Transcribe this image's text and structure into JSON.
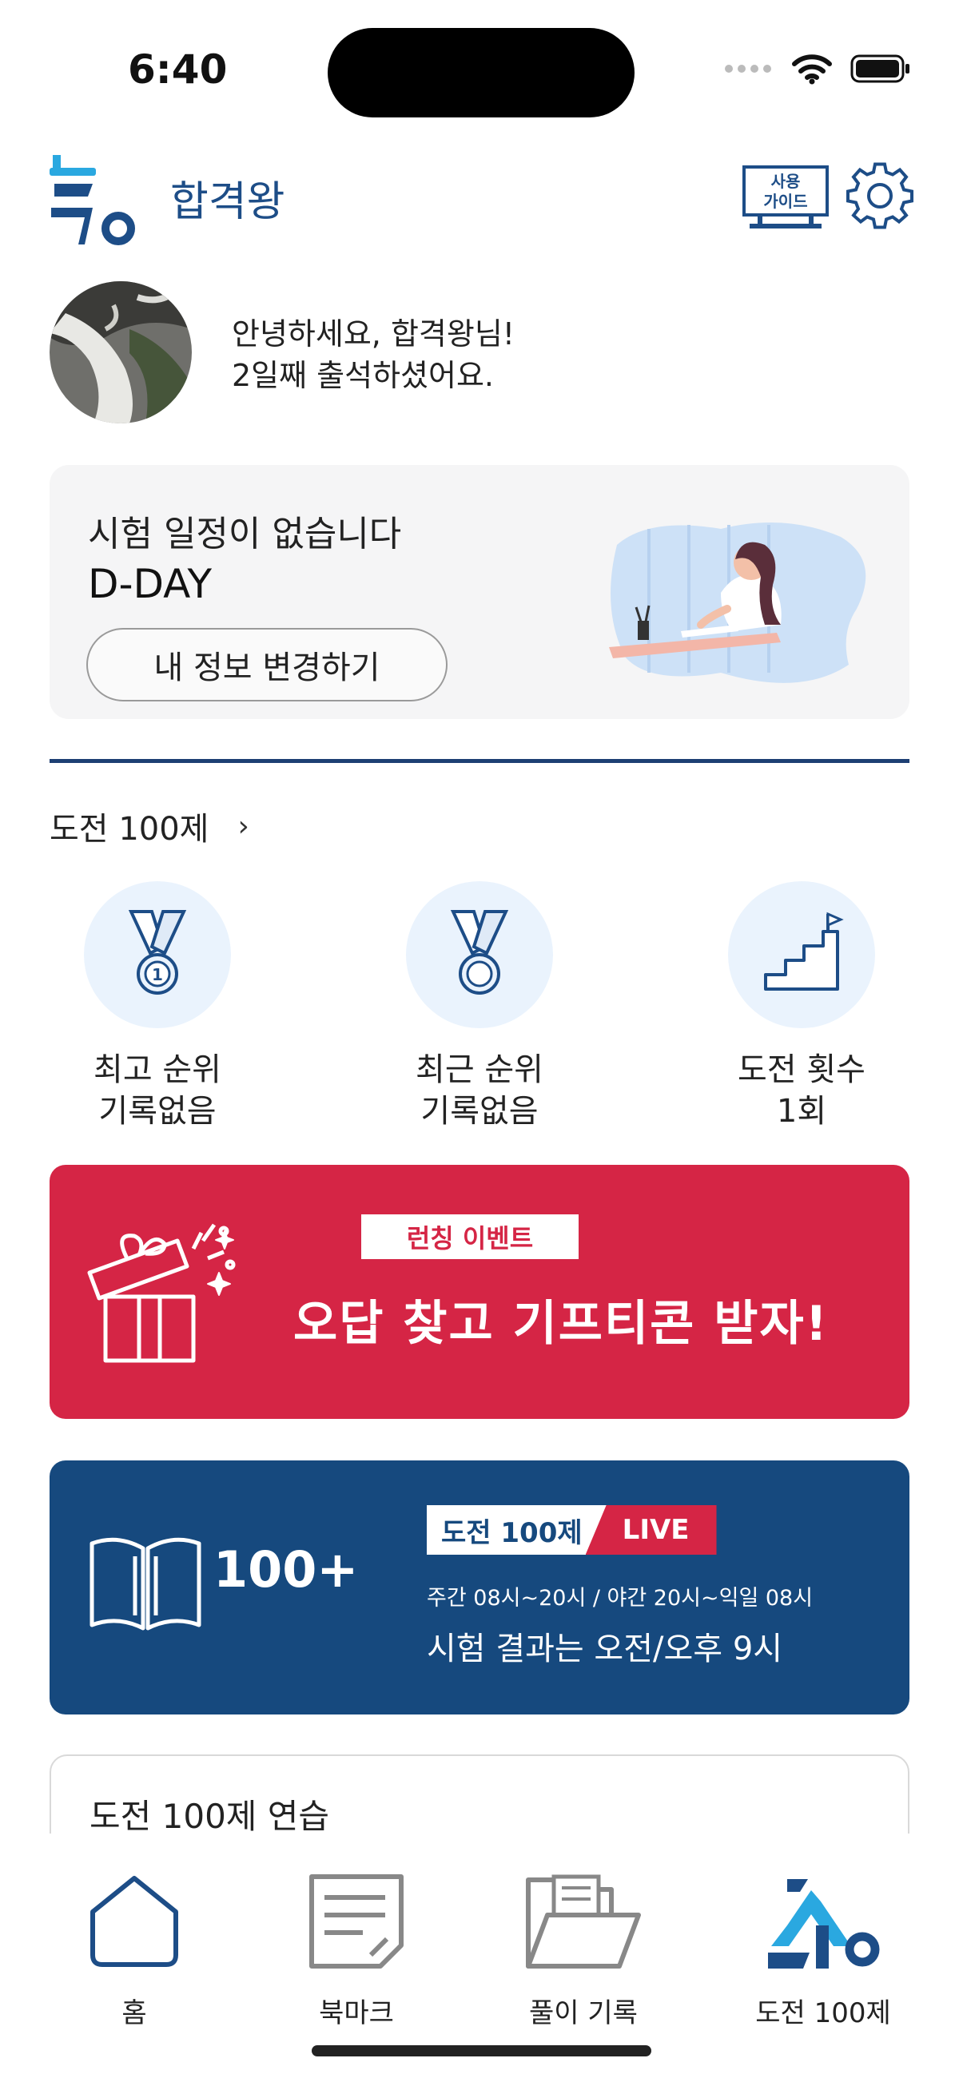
{
  "status": {
    "time": "6:40"
  },
  "header": {
    "app_name": "합격왕",
    "guide_line1": "사용",
    "guide_line2": "가이드"
  },
  "greeting": {
    "line1": "안녕하세요, 합격왕님!",
    "line2": "2일째 출석하셨어요."
  },
  "exam": {
    "title": "시험 일정이 없습니다",
    "dday": "D-DAY",
    "edit_button": "내 정보 변경하기"
  },
  "challenge": {
    "section_title": "도전 100제",
    "chevron": "›",
    "stats": [
      {
        "label": "최고 순위",
        "value": "기록없음",
        "icon": "medal-rank-1-icon"
      },
      {
        "label": "최근 순위",
        "value": "기록없음",
        "icon": "medal-icon"
      },
      {
        "label": "도전 횟수",
        "value": "1회",
        "icon": "stairs-flag-icon"
      }
    ]
  },
  "event_banner": {
    "badge": "런칭 이벤트",
    "headline": "오답 찾고 기프티콘 받자!"
  },
  "challenge_banner": {
    "big_text": "100+",
    "tag_name": "도전 100제",
    "tag_live": "LIVE",
    "hours": "주간 08시~20시 / 야간 20시~익일 08시",
    "result": "시험 결과는 오전/오후 9시"
  },
  "practice": {
    "title": "도전 100제 연습"
  },
  "nav": [
    {
      "label": "홈",
      "icon": "home-icon"
    },
    {
      "label": "북마크",
      "icon": "bookmark-note-icon"
    },
    {
      "label": "풀이 기록",
      "icon": "folder-icon"
    },
    {
      "label": "도전 100제",
      "icon": "challenge-logo-icon"
    }
  ],
  "colors": {
    "brand_navy": "#1d4d87",
    "event_red": "#d52545",
    "banner_blue": "#16497e",
    "accent_cyan": "#2aa8e0"
  }
}
